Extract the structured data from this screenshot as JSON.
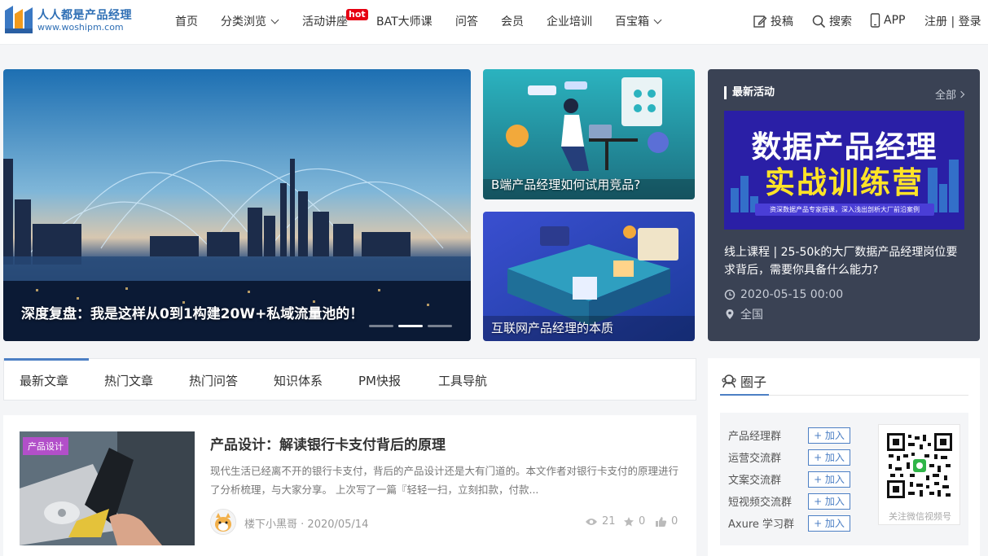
{
  "brand": {
    "name": "人人都是产品经理",
    "url": "www.woshipm.com"
  },
  "nav": [
    {
      "label": "首页"
    },
    {
      "label": "分类浏览"
    },
    {
      "label": "活动讲座"
    },
    {
      "label": "BAT大师课"
    },
    {
      "label": "问答"
    },
    {
      "label": "会员"
    },
    {
      "label": "企业培训"
    },
    {
      "label": "百宝箱"
    }
  ],
  "hot_badge": "hot",
  "header_right": {
    "contribute": "投稿",
    "search": "搜索",
    "app": "APP",
    "auth": "注册 | 登录"
  },
  "carousel": {
    "title": "深度复盘：我是这样从0到1构建20W+私域流量池的！",
    "slide_count": 3,
    "active_index": 1
  },
  "side_cards": [
    {
      "title": "B端产品经理如何试用竞品?"
    },
    {
      "title": "互联网产品经理的本质"
    }
  ],
  "events": {
    "heading": "最新活动",
    "all_link": "全部",
    "banner_line1": "数据产品经理",
    "banner_line2": "实战训练营",
    "banner_sub": "资深数据产品专家授课，深入浅出剖析大厂前沿案例",
    "title": "线上课程 | 25-50k的大厂数据产品经理岗位要求背后，需要你具备什么能力?",
    "date": "2020-05-15 00:00",
    "location": "全国"
  },
  "tabs": [
    {
      "label": "最新文章"
    },
    {
      "label": "热门文章"
    },
    {
      "label": "热门问答"
    },
    {
      "label": "知识体系"
    },
    {
      "label": "PM快报"
    },
    {
      "label": "工具导航"
    }
  ],
  "article": {
    "category": "产品设计",
    "title": "产品设计：解读银行卡支付背后的原理",
    "description": "现代生活已经离不开的银行卡支付，背后的产品设计还是大有门道的。本文作者对银行卡支付的原理进行了分析梳理，与大家分享。 上次写了一篇『轻轻一扫，立刻扣款，付款...",
    "author": "楼下小黑哥",
    "date": "2020/05/14",
    "views": "21",
    "stars": "0",
    "likes": "0"
  },
  "circle": {
    "heading": "圈子",
    "groups": [
      {
        "name": "产品经理群",
        "join": "+ 加入"
      },
      {
        "name": "运营交流群",
        "join": "+ 加入"
      },
      {
        "name": "文案交流群",
        "join": "+ 加入"
      },
      {
        "name": "短视频交流群",
        "join": "+ 加入"
      },
      {
        "name": "Axure 学习群",
        "join": "+ 加入"
      }
    ],
    "qr_label": "关注微信视频号"
  },
  "colors": {
    "accent": "#4c7fc4",
    "hot": "#e60012",
    "events_bg": "#3a4254",
    "category_badge": "#b24fc9",
    "banner_yellow": "#ffe327"
  }
}
